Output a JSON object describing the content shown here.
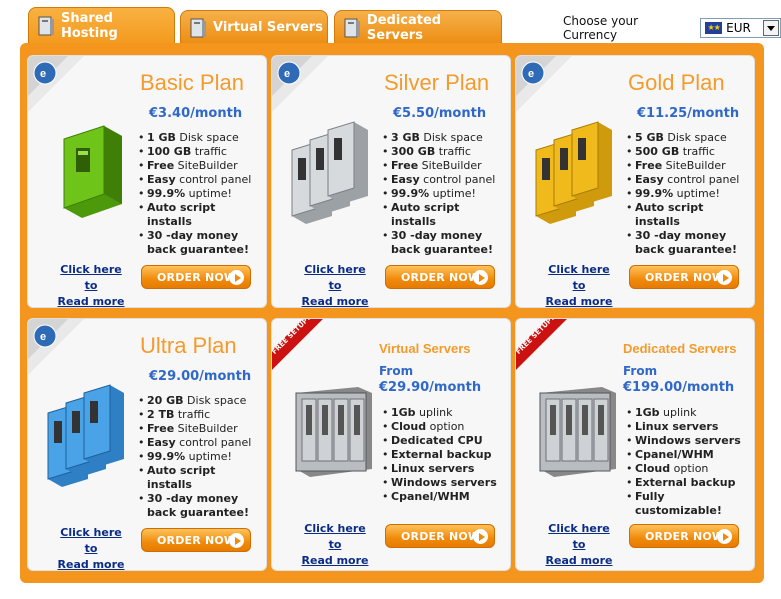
{
  "tabs": [
    {
      "label": "Shared Hosting",
      "active": true
    },
    {
      "label": "Virtual Servers",
      "active": false
    },
    {
      "label": "Dedicated Servers",
      "active": false
    }
  ],
  "currency": {
    "label": "Choose your Currency",
    "value": "EUR",
    "flag": "eu-flag-icon"
  },
  "colors": {
    "accent": "#f4961e",
    "title": "#f39b2d",
    "price": "#2f68c6",
    "link": "#0b2c86"
  },
  "links": {
    "line1": "Click here to",
    "line2": "Read more"
  },
  "order_label": "ORDER NOW",
  "free_setup": "FREE SETUP!",
  "cards": [
    {
      "title": "Basic Plan",
      "price": "€3.40/month",
      "server_color": "green",
      "features": [
        {
          "b": "1 GB",
          "t": " Disk space"
        },
        {
          "b": "100 GB",
          "t": " traffic"
        },
        {
          "b": "Free",
          "t": " SiteBuilder"
        },
        {
          "b": "Easy",
          "t": " control panel"
        },
        {
          "b": "99.9%",
          "t": " uptime!"
        },
        {
          "b": "Auto script installs",
          "t": ""
        },
        {
          "b": "30 -day money back guarantee!",
          "t": ""
        }
      ]
    },
    {
      "title": "Silver Plan",
      "price": "€5.50/month",
      "server_color": "silver",
      "features": [
        {
          "b": "3 GB",
          "t": " Disk space"
        },
        {
          "b": "300 GB",
          "t": " traffic"
        },
        {
          "b": "Free",
          "t": " SiteBuilder"
        },
        {
          "b": "Easy",
          "t": " control panel"
        },
        {
          "b": "99.9%",
          "t": " uptime!"
        },
        {
          "b": "Auto script installs",
          "t": ""
        },
        {
          "b": "30 -day money back guarantee!",
          "t": ""
        }
      ]
    },
    {
      "title": "Gold Plan",
      "price": "€11.25/month",
      "server_color": "gold",
      "features": [
        {
          "b": "5 GB",
          "t": " Disk space"
        },
        {
          "b": "500 GB",
          "t": " traffic"
        },
        {
          "b": "Free",
          "t": " SiteBuilder"
        },
        {
          "b": "Easy",
          "t": " control panel"
        },
        {
          "b": "99.9%",
          "t": " uptime!"
        },
        {
          "b": "Auto script installs",
          "t": ""
        },
        {
          "b": "30 -day money back guarantee!",
          "t": ""
        }
      ]
    },
    {
      "title": "Ultra Plan",
      "price": "€29.00/month",
      "server_color": "blue",
      "features": [
        {
          "b": "20 GB",
          "t": " Disk space"
        },
        {
          "b": "2 TB",
          "t": " traffic"
        },
        {
          "b": "Free",
          "t": " SiteBuilder"
        },
        {
          "b": "Easy",
          "t": " control panel"
        },
        {
          "b": "99.9%",
          "t": " uptime!"
        },
        {
          "b": "Auto script installs",
          "t": ""
        },
        {
          "b": "30 -day money back guarantee!",
          "t": ""
        }
      ]
    },
    {
      "title": "Virtual Servers",
      "from": "From",
      "price": "€29.90/month",
      "server_color": "rack",
      "features": [
        {
          "b": "1Gb",
          "t": " uplink"
        },
        {
          "b": "Cloud",
          "t": " option"
        },
        {
          "b": "Dedicated CPU",
          "t": ""
        },
        {
          "b": "External backup",
          "t": ""
        },
        {
          "b": "Linux servers",
          "t": ""
        },
        {
          "b": "Windows servers",
          "t": ""
        },
        {
          "b": "Cpanel/WHM",
          "t": ""
        }
      ]
    },
    {
      "title": "Dedicated Servers",
      "from": "From",
      "price": "€199.00/month",
      "server_color": "rack",
      "features": [
        {
          "b": "1Gb",
          "t": " uplink"
        },
        {
          "b": "Linux servers",
          "t": ""
        },
        {
          "b": "Windows servers",
          "t": ""
        },
        {
          "b": "Cpanel/WHM",
          "t": ""
        },
        {
          "b": "Cloud",
          "t": " option"
        },
        {
          "b": "External backup",
          "t": ""
        },
        {
          "b": "Fully customizable!",
          "t": ""
        }
      ]
    }
  ]
}
